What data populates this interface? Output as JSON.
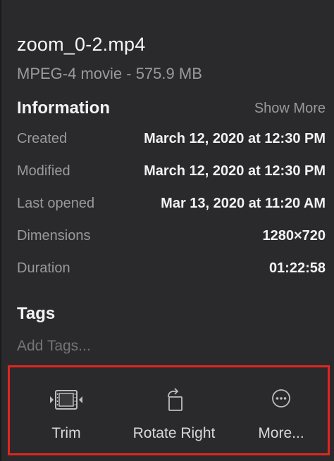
{
  "file": {
    "name": "zoom_0-2.mp4",
    "kind": "MPEG-4 movie - 575.9 MB"
  },
  "information": {
    "title": "Information",
    "show_more_label": "Show More",
    "rows": [
      {
        "label": "Created",
        "value": "March 12, 2020 at 12:30 PM"
      },
      {
        "label": "Modified",
        "value": "March 12, 2020 at 12:30 PM"
      },
      {
        "label": "Last opened",
        "value": "Mar 13, 2020 at 11:20 AM"
      },
      {
        "label": "Dimensions",
        "value": "1280×720"
      },
      {
        "label": "Duration",
        "value": "01:22:58"
      }
    ]
  },
  "tags": {
    "title": "Tags",
    "placeholder": "Add Tags..."
  },
  "actions": {
    "trim_label": "Trim",
    "trim_icon": "film-trim-icon",
    "rotate_label": "Rotate Right",
    "rotate_icon": "rotate-right-icon",
    "more_label": "More...",
    "more_icon": "ellipsis-circle-icon"
  },
  "colors": {
    "panel_background": "#2a2a2c",
    "highlight_border": "#e0261e",
    "secondary_text": "#9a9a9d"
  }
}
